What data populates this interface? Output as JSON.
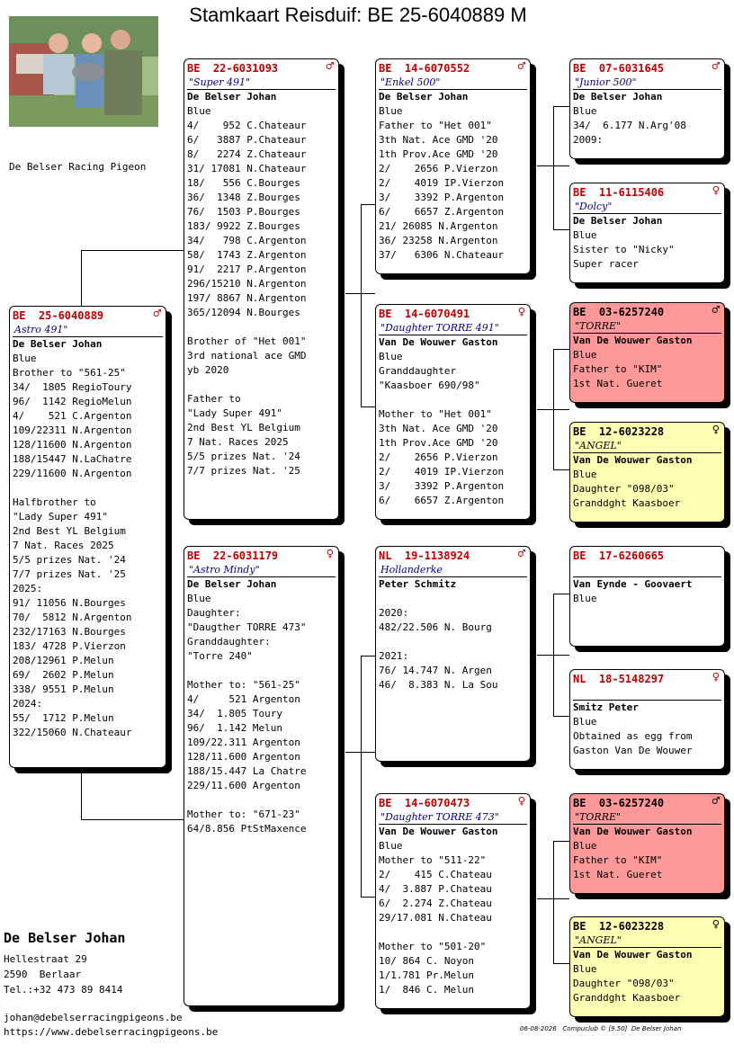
{
  "title": "Stamkaart Reisduif: BE  25-6040889 M",
  "club_name": "De Belser Racing Pigeon",
  "footer": {
    "name": "De Belser Johan",
    "address": "Hellestraat 29\n2590  Berlaar\nTel.:+32 473 89 8414",
    "contact": "johan@debelserracingpigeons.be\nhttps://www.debelserracingpigeons.be",
    "date": "06-08-2026",
    "software": "Compuclub © [9.50]  De Belser Johan"
  },
  "cards": {
    "main": {
      "ring": "BE  25-6040889",
      "sex": "♂",
      "nick": "Astro 491\"",
      "owner": "De Belser Johan",
      "lines": "Blue\nBrother to \"561-25\"\n34/  1805 RegioToury\n96/  1142 RegioMelun\n4/    521 C.Argenton\n109/22311 N.Argenton\n128/11600 N.Argenton\n188/15447 N.LaChatre\n229/11600 N.Argenton\n\nHalfbrother to\n\"Lady Super 491\"\n2nd Best YL Belgium\n7 Nat. Races 2025\n5/5 prizes Nat. '24\n7/7 prizes Nat. '25\n2025:\n91/ 11056 N.Bourges\n70/  5812 N.Argenton\n232/17163 N.Bourges\n183/ 4728 P.Vierzon\n208/12961 P.Melun\n69/  2602 P.Melun\n338/ 9551 P.Melun\n2024:\n55/  1712 P.Melun\n322/15060 N.Chateaur"
    },
    "sire": {
      "ring": "BE  22-6031093",
      "sex": "♂",
      "nick": "\"Super 491\"",
      "owner": "De Belser Johan",
      "lines": "Blue\n4/    952 C.Chateaur\n6/   3887 P.Chateaur\n8/   2274 Z.Chateaur\n31/ 17081 N.Chateaur\n18/   556 C.Bourges\n36/  1348 Z.Bourges\n76/  1503 P.Bourges\n183/ 9922 Z.Bourges\n34/   798 C.Argenton\n58/  1743 Z.Argenton\n91/  2217 P.Argenton\n296/15210 N.Argenton\n197/ 8867 N.Argenton\n365/12094 N.Bourges\n\nBrother of \"Het 001\"\n3rd national ace GMD\nyb 2020\n\nFather to\n\"Lady Super 491\"\n2nd Best YL Belgium\n7 Nat. Races 2025\n5/5 prizes Nat. '24\n7/7 prizes Nat. '25"
    },
    "dam": {
      "ring": "BE  22-6031179",
      "sex": "♀",
      "nick": "\"Astro Mindy\"",
      "owner": "De Belser Johan",
      "lines": "Blue\nDaughter:\n\"Daugther TORRE 473\"\nGranddaughter:\n\"Torre 240\"\n\nMother to: \"561-25\"\n4/     521 Argenton\n34/  1.805 Toury\n96/  1.142 Melun\n109/22.311 Argenton\n128/11.600 Argenton\n188/15.447 La Chatre\n229/11.600 Argenton\n\nMother to: \"671-23\"\n64/8.856 PtStMaxence"
    },
    "ss": {
      "ring": "BE  14-6070552",
      "sex": "♂",
      "nick": "\"Enkel 500\"",
      "owner": "De Belser Johan",
      "lines": "Blue\nFather to \"Het 001\"\n3th Nat. Ace GMD '20\n1th Prov.Ace GMD '20\n2/    2656 P.Vierzon\n2/    4019 IP.Vierzon\n3/    3392 P.Argenton\n6/    6657 Z.Argenton\n21/ 26085 N.Argenton\n36/ 23258 N.Argenton\n37/   6306 N.Chateaur"
    },
    "sd": {
      "ring": "BE  14-6070491",
      "sex": "♀",
      "nick": "\"Daughter TORRE 491\"",
      "owner": "Van De Wouwer Gaston",
      "lines": "Blue\nGranddaughter\n\"Kaasboer 690/98\"\n\nMother to \"Het 001\"\n3th Nat. Ace GMD '20\n1th Prov.Ace GMD '20\n2/    2656 P.Vierzon\n2/    4019 IP.Vierzon\n3/    3392 P.Argenton\n6/    6657 Z.Argenton"
    },
    "ds": {
      "ring": "NL  19-1138924",
      "sex": "♂",
      "nick": "Hollanderke",
      "owner": "Peter Schmitz",
      "lines": "\n2020:\n482/22.506 N. Bourg\n\n2021:\n76/ 14.747 N. Argen\n46/  8.383 N. La Sou"
    },
    "dd": {
      "ring": "BE  14-6070473",
      "sex": "♀",
      "nick": "\"Daughter TORRE 473\"",
      "owner": "Van De Wouwer Gaston",
      "lines": "Blue\nMother to \"511-22\"\n2/    415 C.Chateau\n4/  3.887 P.Chateau\n6/  2.274 Z.Chateau\n29/17.081 N.Chateau\n\nMother to \"501-20\"\n10/ 864 C. Noyon\n1/1.781 Pr.Melun\n1/  846 C. Melun"
    },
    "sss": {
      "ring": "BE  07-6031645",
      "sex": "♂",
      "nick": "\"Junior 500\"",
      "owner": "De Belser Johan",
      "lines": "Blue\n34/  6.177 N.Arg'08\n2009:"
    },
    "ssd": {
      "ring": "BE  11-6115406",
      "sex": "♀",
      "nick": "\"Dolcy\"",
      "owner": "De Belser Johan",
      "lines": "Blue\nSister to \"Nicky\"\nSuper racer"
    },
    "sds": {
      "ring": "BE  03-6257240",
      "sex": "♂",
      "nick": "\"TORRE\"",
      "owner": "Van De Wouwer Gaston",
      "lines": "Blue\nFather to \"KIM\"\n1st Nat. Gueret"
    },
    "sdd": {
      "ring": "BE  12-6023228",
      "sex": "♀",
      "nick": "\"ANGEL\"",
      "owner": "Van De Wouwer Gaston",
      "lines": "Blue\nDaughter \"098/03\"\nGranddght Kaasboer"
    },
    "dss": {
      "ring": "BE  17-6260665",
      "sex": "",
      "nick": "",
      "owner": "Van Eynde - Goovaert",
      "lines": "Blue"
    },
    "dsd": {
      "ring": "NL  18-5148297",
      "sex": "♀",
      "nick": "",
      "owner": "Smitz Peter",
      "lines": "Blue\nObtained as egg from\nGaston Van De Wouwer"
    },
    "dds": {
      "ring": "BE  03-6257240",
      "sex": "♂",
      "nick": "\"TORRE\"",
      "owner": "Van De Wouwer Gaston",
      "lines": "Blue\nFather to \"KIM\"\n1st Nat. Gueret"
    },
    "ddd": {
      "ring": "BE  12-6023228",
      "sex": "♀",
      "nick": "\"ANGEL\"",
      "owner": "Van De Wouwer Gaston",
      "lines": "Blue\nDaughter \"098/03\"\nGranddght Kaasboer"
    }
  }
}
